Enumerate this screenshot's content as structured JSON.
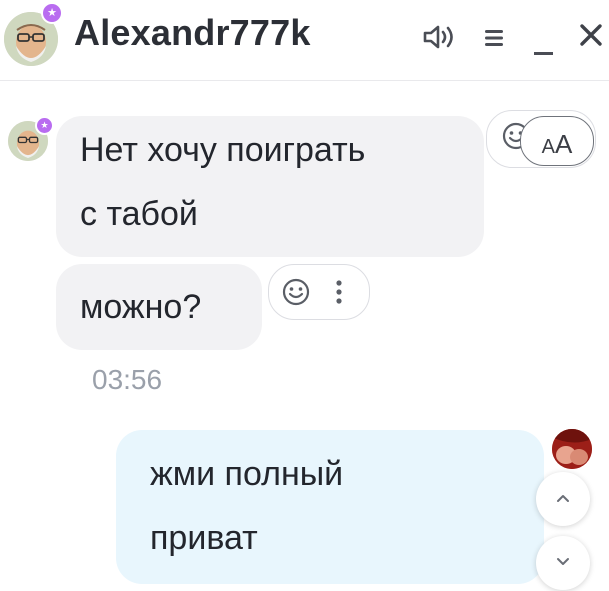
{
  "header": {
    "title": "Alexandr777k",
    "icons": [
      "speaker-icon",
      "menu-icon",
      "minimize-icon",
      "close-icon"
    ]
  },
  "messages": [
    {
      "direction": "incoming",
      "lines": [
        "Нет хочу поиграть",
        "с табой"
      ]
    },
    {
      "direction": "incoming",
      "text": "можно?"
    },
    {
      "direction": "outgoing",
      "lines": [
        "жми полный",
        "приват"
      ]
    }
  ],
  "timestamp": "03:56",
  "text_size_button": {
    "big": "A",
    "small": "A"
  },
  "colors": {
    "incoming_bubble": "#f2f2f4",
    "outgoing_bubble": "#e8f6fd",
    "badge": "#b96cf0",
    "title": "#2c2f36"
  }
}
